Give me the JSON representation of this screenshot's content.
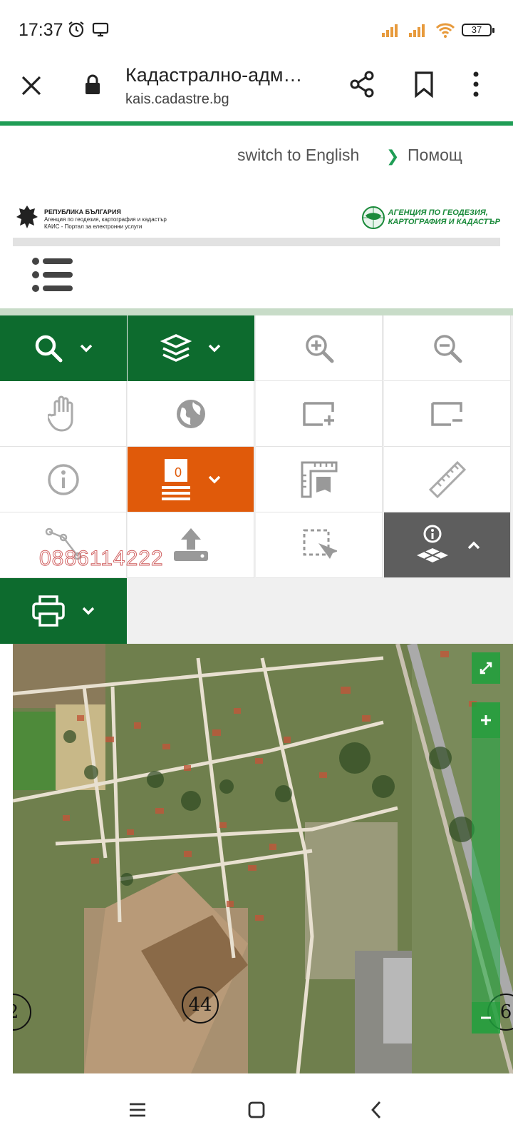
{
  "status": {
    "time": "17:37",
    "battery": "37"
  },
  "browser": {
    "page_title": "Кадастрално-адм…",
    "domain": "kais.cadastre.bg"
  },
  "topnav": {
    "lang_link": "switch to English",
    "help_link": "Помощ"
  },
  "header": {
    "left_logo_lines": [
      "РЕПУБЛИКА БЪЛГАРИЯ",
      "Агенция по геодезия, картография и кадастър",
      "КАИС - Портал за електронни услуги"
    ],
    "right_logo_lines": [
      "АГЕНЦИЯ ПО ГЕОДЕЗИЯ,",
      "КАРТОГРАФИЯ И КАДАСТЪР"
    ]
  },
  "toolbar": {
    "selection_count": "0",
    "watermark": "0886114222"
  },
  "map": {
    "sheet_labels": [
      "2",
      "44",
      "6"
    ]
  },
  "colors": {
    "primary_green": "#0d6b2e",
    "accent_orange": "#e05a0a",
    "dark_gray": "#5e5e5e",
    "progress_green": "#1f9d55"
  }
}
